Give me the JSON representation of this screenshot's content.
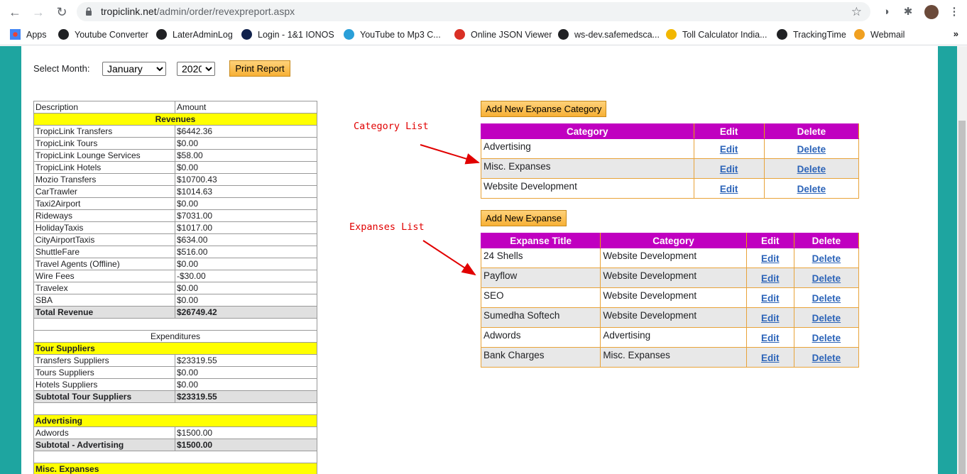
{
  "browser": {
    "url_host": "tropiclink.net",
    "url_path": "/admin/order/revexpreport.aspx",
    "bookmarks": [
      {
        "label": "Apps",
        "color": "#4285f4"
      },
      {
        "label": "Youtube Converter",
        "color": "#202124"
      },
      {
        "label": "LaterAdminLog",
        "color": "#202124"
      },
      {
        "label": "Login - 1&1 IONOS",
        "color": "#11224d"
      },
      {
        "label": "YouTube to Mp3 C...",
        "color": "#2a9fd8"
      },
      {
        "label": "Online JSON Viewer",
        "color": "#d93025"
      },
      {
        "label": "ws-dev.safemedsca...",
        "color": "#202124"
      },
      {
        "label": "Toll Calculator India...",
        "color": "#f2b700"
      },
      {
        "label": "TrackingTime",
        "color": "#202124"
      },
      {
        "label": "Webmail",
        "color": "#f0a020"
      }
    ],
    "more": "»"
  },
  "form": {
    "select_month_label": "Select Month:",
    "month": "January",
    "year": "2020",
    "print_button": "Print Report"
  },
  "report": {
    "header": {
      "description": "Description",
      "amount": "Amount"
    },
    "revenues_title": "Revenues",
    "revenues": [
      {
        "name": "TropicLink Transfers",
        "amount": "$6442.36"
      },
      {
        "name": "TropicLink Tours",
        "amount": "$0.00"
      },
      {
        "name": "TropicLink Lounge Services",
        "amount": "$58.00"
      },
      {
        "name": "TropicLink Hotels",
        "amount": "$0.00"
      },
      {
        "name": "Mozio Transfers",
        "amount": "$10700.43"
      },
      {
        "name": "CarTrawler",
        "amount": "$1014.63"
      },
      {
        "name": "Taxi2Airport",
        "amount": "$0.00"
      },
      {
        "name": "Rideways",
        "amount": "$7031.00"
      },
      {
        "name": "HolidayTaxis",
        "amount": "$1017.00"
      },
      {
        "name": "CityAirportTaxis",
        "amount": "$634.00"
      },
      {
        "name": "ShuttleFare",
        "amount": "$516.00"
      },
      {
        "name": "Travel Agents (Offline)",
        "amount": "$0.00"
      },
      {
        "name": "Wire Fees",
        "amount": "-$30.00"
      },
      {
        "name": "Travelex",
        "amount": "$0.00"
      },
      {
        "name": "SBA",
        "amount": "$0.00"
      }
    ],
    "total_revenue": {
      "name": "Total Revenue",
      "amount": "$26749.42"
    },
    "expenditures_title": "Expenditures",
    "tour_suppliers_title": "Tour Suppliers",
    "tour_suppliers": [
      {
        "name": "Transfers Suppliers",
        "amount": "$23319.55"
      },
      {
        "name": "Tours Suppliers",
        "amount": "$0.00"
      },
      {
        "name": "Hotels Suppliers",
        "amount": "$0.00"
      }
    ],
    "subtotal_tour": {
      "name": "Subtotal Tour Suppliers",
      "amount": "$23319.55"
    },
    "advertising_title": "Advertising",
    "advertising": [
      {
        "name": "Adwords",
        "amount": "$1500.00"
      }
    ],
    "subtotal_advertising": {
      "name": "Subtotal - Advertising",
      "amount": "$1500.00"
    },
    "misc_title": "Misc. Expanses"
  },
  "annotations": {
    "category_list": "Category List",
    "expanses_list": "Expanses List"
  },
  "categories": {
    "add_button": "Add New Expanse Category",
    "headers": [
      "Category",
      "Edit",
      "Delete"
    ],
    "rows": [
      {
        "category": "Advertising",
        "edit": "Edit",
        "delete": "Delete"
      },
      {
        "category": "Misc. Expanses",
        "edit": "Edit",
        "delete": "Delete"
      },
      {
        "category": "Website Development",
        "edit": "Edit",
        "delete": "Delete"
      }
    ]
  },
  "expanses": {
    "add_button": "Add New Expanse",
    "headers": [
      "Expanse Title",
      "Category",
      "Edit",
      "Delete"
    ],
    "rows": [
      {
        "title": "24 Shells",
        "category": "Website Development",
        "edit": "Edit",
        "delete": "Delete"
      },
      {
        "title": "Payflow",
        "category": "Website Development",
        "edit": "Edit",
        "delete": "Delete"
      },
      {
        "title": "SEO",
        "category": "Website Development",
        "edit": "Edit",
        "delete": "Delete"
      },
      {
        "title": "Sumedha Softech",
        "category": "Website Development",
        "edit": "Edit",
        "delete": "Delete"
      },
      {
        "title": "Adwords",
        "category": "Advertising",
        "edit": "Edit",
        "delete": "Delete"
      },
      {
        "title": "Bank Charges",
        "category": "Misc. Expanses",
        "edit": "Edit",
        "delete": "Delete"
      }
    ]
  },
  "colors": {
    "teal": "#1ea5a0",
    "header_magenta": "#c000c0",
    "section_yellow": "#ffff00",
    "button_orange": "#f7b035",
    "link_blue": "#2b63b8",
    "annotation_red": "#e10000"
  }
}
